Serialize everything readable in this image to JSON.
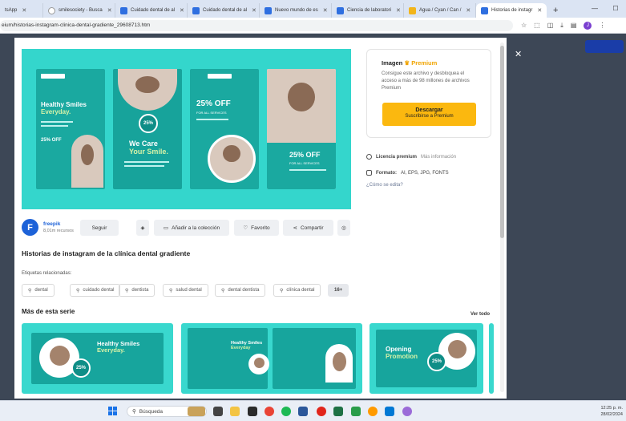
{
  "browser": {
    "tabs": [
      {
        "label": "tsApp",
        "active": false
      },
      {
        "label": "smilesociety - Busca",
        "active": false
      },
      {
        "label": "Cuidado dental de al",
        "active": false
      },
      {
        "label": "Cuidado dental de al",
        "active": false
      },
      {
        "label": "Nuevo mundo de es",
        "active": false
      },
      {
        "label": "Ciencia de laboratori",
        "active": false
      },
      {
        "label": "Agua / Cyan / Can /",
        "active": false
      },
      {
        "label": "Historias de instagr",
        "active": true
      }
    ],
    "new_tab": "+",
    "url": "eium/historias-instagram-clinica-dental-gradiente_29608713.htm"
  },
  "modal": {
    "close": "✕",
    "premium": {
      "title": "Imagen",
      "badge": "Premium",
      "description": "Consigue este archivo y desbloquea el acceso a más de 98 millones de archivos Premium",
      "download_label": "Descargar",
      "download_sub": "Suscribirse a Premium"
    },
    "license": {
      "label": "Licencia premium",
      "more": "Más información"
    },
    "format": {
      "label": "Formato:",
      "value": "AI, EPS, JPG, FONTS"
    },
    "edit_link": "¿Cómo se edita?",
    "author": {
      "logo": "F",
      "name": "freepik",
      "resources": "8,01m recursos",
      "follow": "Seguir"
    },
    "actions": {
      "collection": "Añadir a la colección",
      "favorite": "Favorito",
      "share": "Compartir"
    },
    "title": "Historias de instagram de la clínica dental gradiente",
    "tags_label": "Etiquetas relacionadas:",
    "tags": [
      "dental",
      "cuidado dental",
      "dentista",
      "salud dental",
      "dental dentista",
      "clínica dental",
      "16+"
    ],
    "series": {
      "title": "Más de esta serie",
      "see_all": "Ver todo"
    },
    "preview": {
      "s1": {
        "logo": "YOURLOGO",
        "h1": "Healthy Smiles",
        "h2": "Everyday.",
        "off": "25% OFF"
      },
      "s2": {
        "pct": "25%",
        "h1": "We Care",
        "h2": "Your Smile."
      },
      "s3": {
        "logo": "YOURLOGO",
        "off": "25% OFF",
        "sub": "FOR ALL SERVICES"
      },
      "s4": {
        "off": "25% OFF",
        "sub": "FOR ALL SERVICES"
      }
    },
    "thumbs": {
      "t1": {
        "h1": "Healthy Smiles",
        "h2": "Everyday.",
        "pct": "25%"
      },
      "t2": {
        "h1": "Healthy Smiles",
        "h2": "Everyday"
      },
      "t3": {
        "h1": "Opening",
        "h2": "Promotion",
        "pct": "25%"
      }
    }
  },
  "taskbar": {
    "search": "Búsqueda",
    "time": "12:25 p. m.",
    "date": "28/02/2024"
  },
  "colors": {
    "teal": "#34d6cc",
    "dark_teal": "#1aa9a0",
    "premium": "#f0a400",
    "download": "#fbb80f",
    "brand": "#1d62d8"
  }
}
